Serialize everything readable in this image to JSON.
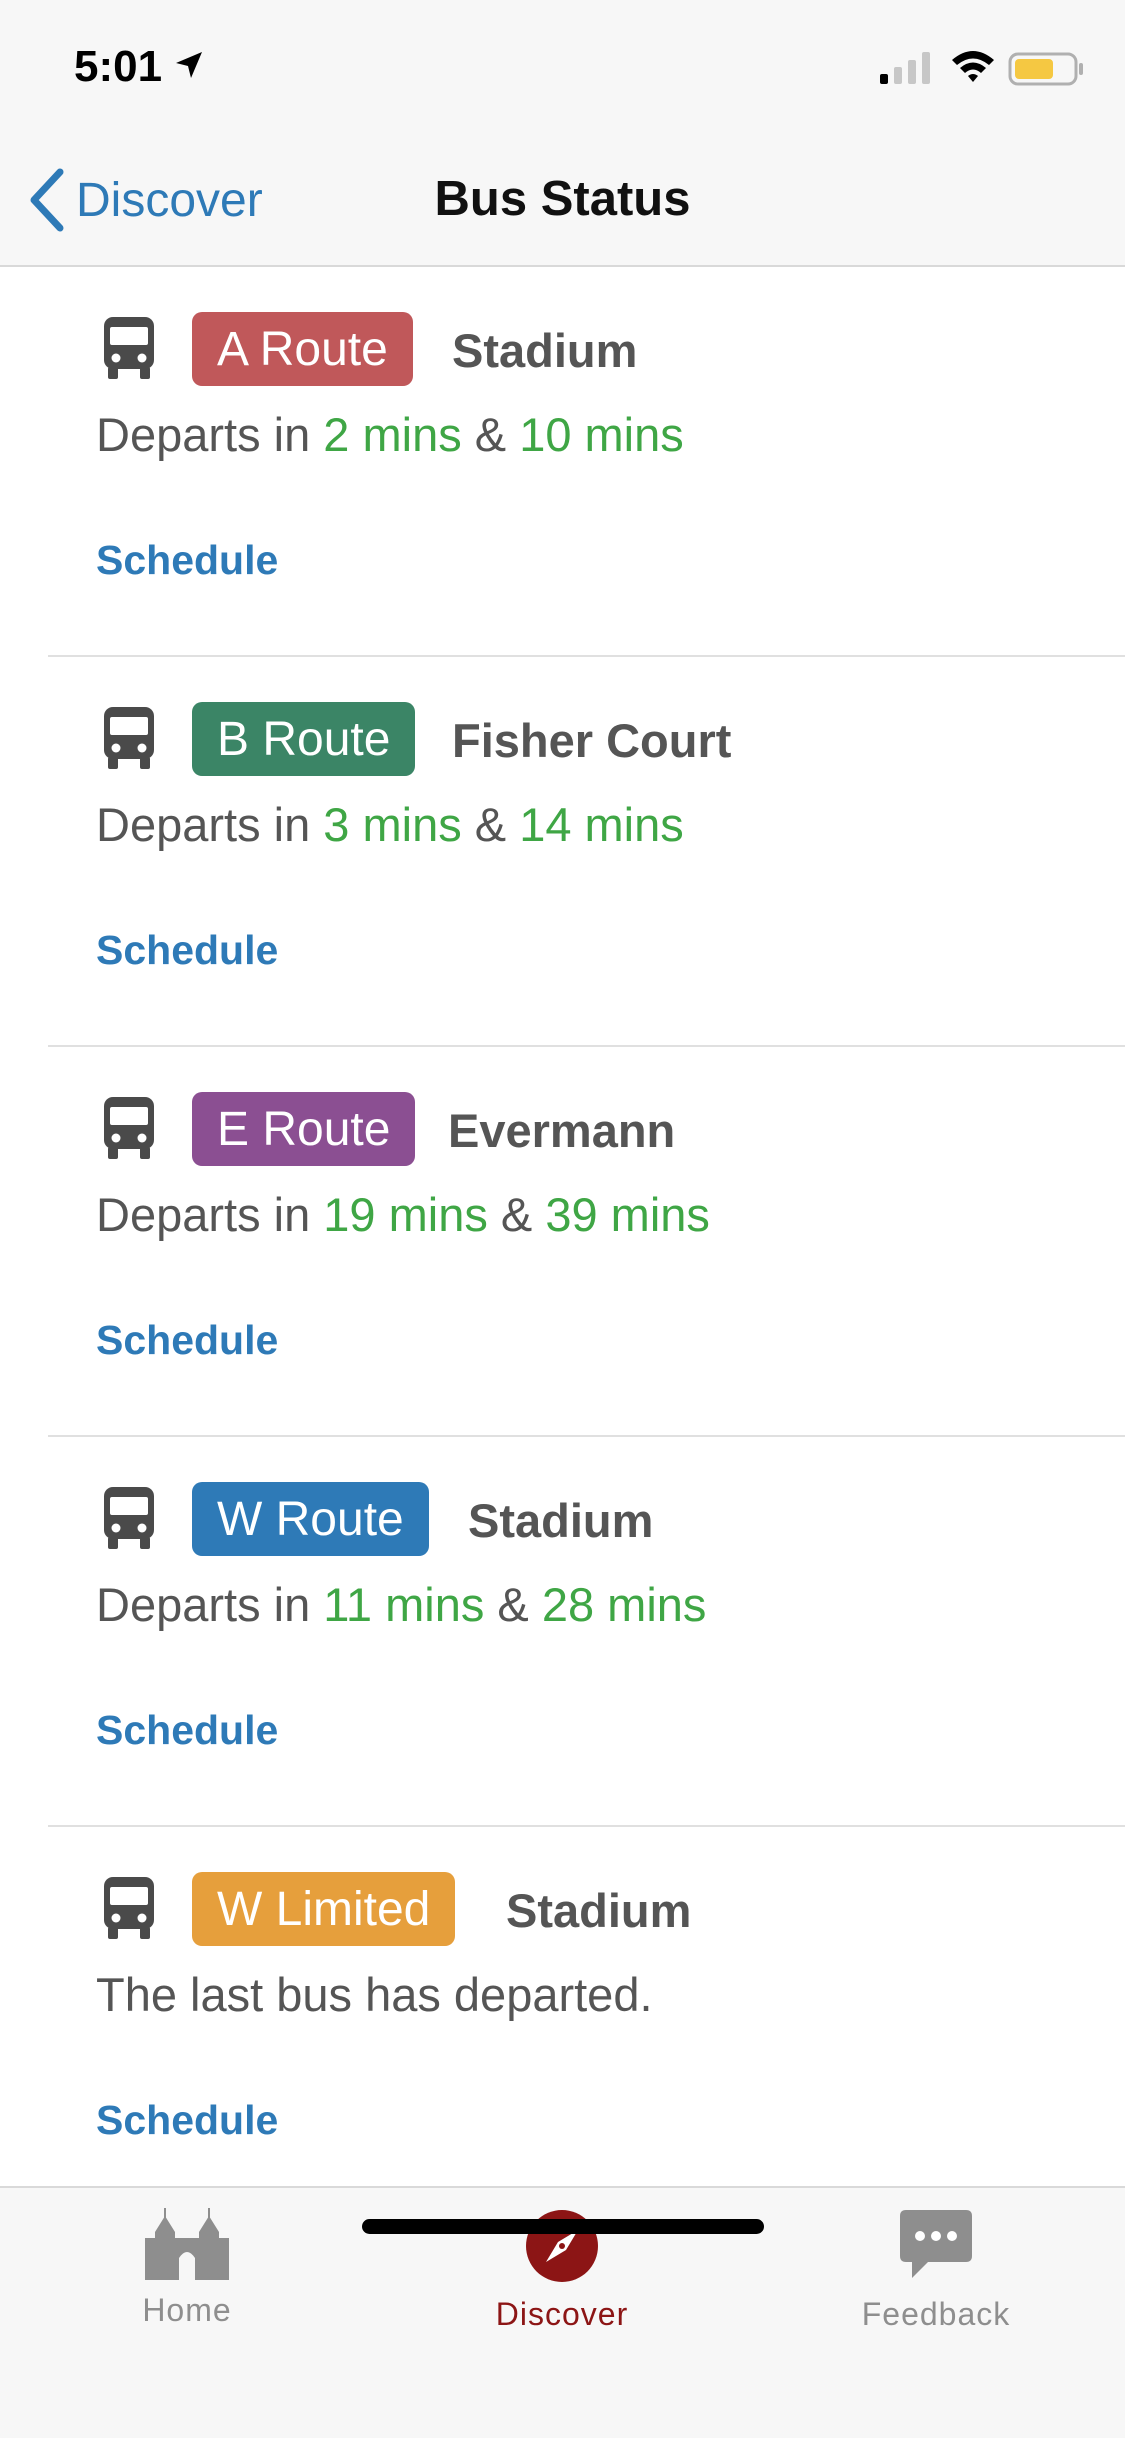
{
  "status_bar": {
    "time": "5:01"
  },
  "nav": {
    "back_label": "Discover",
    "title": "Bus Status"
  },
  "routes": [
    {
      "badge": "A Route",
      "badge_color": "#c0585a",
      "destination": "Stadium",
      "departs_prefix": "Departs in ",
      "time1": "2 mins",
      "separator": " & ",
      "time2": "10 mins",
      "schedule": "Schedule"
    },
    {
      "badge": "B Route",
      "badge_color": "#3b8566",
      "destination": "Fisher Court",
      "departs_prefix": "Departs in ",
      "time1": "3 mins",
      "separator": " & ",
      "time2": "14 mins",
      "schedule": "Schedule"
    },
    {
      "badge": "E Route",
      "badge_color": "#8b4f92",
      "destination": "Evermann",
      "departs_prefix": "Departs in ",
      "time1": "19 mins",
      "separator": " & ",
      "time2": "39 mins",
      "schedule": "Schedule"
    },
    {
      "badge": "W Route",
      "badge_color": "#2e7ab7",
      "destination": "Stadium",
      "departs_prefix": "Departs in ",
      "time1": "11 mins",
      "separator": " & ",
      "time2": "28 mins",
      "schedule": "Schedule"
    },
    {
      "badge": "W Limited",
      "badge_color": "#e69f3c",
      "destination": "Stadium",
      "message": "The last bus has departed.",
      "schedule": "Schedule"
    }
  ],
  "tabs": [
    {
      "label": "Home",
      "icon": "home-icon"
    },
    {
      "label": "Discover",
      "icon": "compass-icon",
      "active": true
    },
    {
      "label": "Feedback",
      "icon": "chat-icon"
    }
  ],
  "colors": {
    "accent_blue": "#2e7ab7",
    "mins_green": "#3fa645",
    "active_red": "#8c1515"
  }
}
